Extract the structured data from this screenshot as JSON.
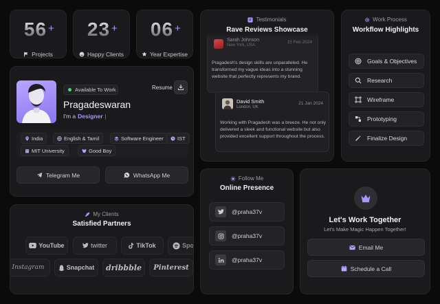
{
  "stats": [
    {
      "number": "56",
      "plus": "+",
      "label": "Projects",
      "icon": "flag-icon"
    },
    {
      "number": "23",
      "plus": "+",
      "label": "Happy Clients",
      "icon": "smile-icon"
    },
    {
      "number": "06",
      "plus": "+",
      "label": "Year Expertise",
      "icon": "badge-icon"
    }
  ],
  "profile": {
    "status": "Available To Work",
    "resume_label": "Resume",
    "name": "Pragadeswaran",
    "role_prefix": "I'm a",
    "role": "Designer",
    "role_suffix": "|",
    "tags": [
      {
        "label": "India",
        "icon": "location-pin-icon"
      },
      {
        "label": "English & Tamil",
        "icon": "globe-icon"
      },
      {
        "label": "Software Engineer",
        "icon": "layers-icon"
      },
      {
        "label": "IST",
        "icon": "clock-icon"
      },
      {
        "label": "MIT University",
        "icon": "building-icon"
      },
      {
        "label": "Good Boy",
        "icon": "dog-icon"
      }
    ],
    "telegram_label": "Telegram Me",
    "whatsapp_label": "WhatsApp Me"
  },
  "testimonials": {
    "kicker": "Testimonials",
    "title": "Rave Reviews Showcase",
    "reviews": [
      {
        "name": "Sarah Johnson",
        "location": "New York, USA",
        "date": "15 Feb 2024",
        "text": "Pragadesh's design skills are unparalleled. He transformed my vague ideas into a stunning website that perfectly represents my brand."
      },
      {
        "name": "David Smith",
        "location": "London, UK",
        "date": "21 Jan 2024",
        "text": "Working with Pragadesh was a breeze. He not only delivered a sleek and functional website but also provided excellent support throughout the process."
      }
    ]
  },
  "workflow": {
    "kicker": "Work Process",
    "title": "Workflow Highlights",
    "items": [
      {
        "label": "Goals & Objectives",
        "icon": "target-icon"
      },
      {
        "label": "Research",
        "icon": "magnifier-icon"
      },
      {
        "label": "Wireframe",
        "icon": "frame-icon"
      },
      {
        "label": "Prototyping",
        "icon": "prototype-icon"
      },
      {
        "label": "Finalize Design",
        "icon": "wand-icon"
      }
    ]
  },
  "clients": {
    "kicker": "My Clients",
    "title": "Satisfied Partners",
    "row1": [
      "YouTube",
      "twitter",
      "TikTok",
      "Spotify"
    ],
    "row2": [
      "Instagram",
      "Snapchat",
      "dribbble",
      "Pinterest"
    ]
  },
  "presence": {
    "kicker": "Follow Me",
    "title": "Online Presence",
    "links": [
      {
        "handle": "@praha37v",
        "icon": "twitter-icon"
      },
      {
        "handle": "@praha37v",
        "icon": "instagram-icon"
      },
      {
        "handle": "@praha37v",
        "icon": "linkedin-icon"
      }
    ]
  },
  "cta": {
    "title": "Let's Work Together",
    "subtitle": "Let's Make Magic Happen Together!",
    "email_label": "Email Me",
    "call_label": "Schedule a Call"
  },
  "colors": {
    "accent": "#a995ff",
    "card": "#1a1a1c",
    "status_green": "#3ddc84"
  }
}
